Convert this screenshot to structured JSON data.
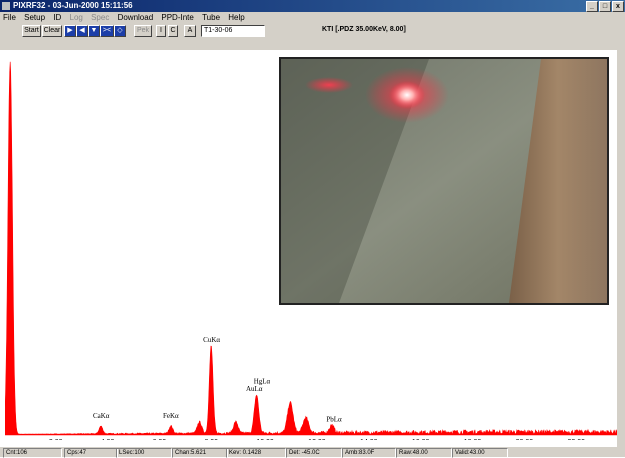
{
  "window": {
    "title": "PIXRF32 - 03-Jun-2000 15:11:56",
    "controls": [
      "_",
      "□",
      "x"
    ]
  },
  "menu": [
    "File",
    "Setup",
    "ID",
    "Log",
    "Spec",
    "Download",
    "PPD-Inte",
    "Tube",
    "Help"
  ],
  "menu_disabled": [
    false,
    false,
    false,
    true,
    true,
    false,
    false,
    false,
    false
  ],
  "toolbar": {
    "start": "Start",
    "clear": "Clear",
    "blue_buttons": [
      "▶",
      "◀",
      "▼",
      "><",
      "◇"
    ],
    "peak": "Pek",
    "i": "I",
    "c": "C",
    "a": "A",
    "run_id": "T1-30-06",
    "status": "KTI  [.PDZ 35.00KeV, 8.00]"
  },
  "chart_data": {
    "type": "line",
    "xlim": [
      0,
      23.6
    ],
    "ylim": [
      0,
      100
    ],
    "x_ticks": [
      "2.00",
      "4.00",
      "6.00",
      "8.00",
      "10.00",
      "12.00",
      "14.00",
      "16.00",
      "18.00",
      "20.00",
      "22.00"
    ],
    "x_tick_values": [
      2,
      4,
      6,
      8,
      10,
      12,
      14,
      16,
      18,
      20,
      22
    ],
    "peaks": [
      {
        "x": 0.2,
        "h": 98,
        "w": 0.12
      },
      {
        "x": 3.7,
        "h": 2,
        "w": 0.1
      },
      {
        "x": 6.4,
        "h": 2,
        "w": 0.1
      },
      {
        "x": 7.5,
        "h": 3,
        "w": 0.12
      },
      {
        "x": 7.95,
        "h": 23,
        "w": 0.1
      },
      {
        "x": 8.9,
        "h": 3,
        "w": 0.12
      },
      {
        "x": 9.7,
        "h": 10,
        "w": 0.12
      },
      {
        "x": 11.0,
        "h": 8,
        "w": 0.15
      },
      {
        "x": 11.6,
        "h": 4,
        "w": 0.15
      },
      {
        "x": 12.6,
        "h": 2,
        "w": 0.12
      }
    ],
    "color": "#ff0000",
    "annotations": [
      {
        "label": "CaKα",
        "x": 3.7,
        "y": 4
      },
      {
        "label": "FeKα",
        "x": 6.4,
        "y": 4
      },
      {
        "label": "CuKα",
        "x": 7.95,
        "y": 24
      },
      {
        "label": "HgLα",
        "x": 9.9,
        "y": 13
      },
      {
        "label": "AuLα",
        "x": 9.6,
        "y": 11
      },
      {
        "label": "PbLα",
        "x": 12.7,
        "y": 3
      }
    ]
  },
  "status": [
    {
      "text": "Cnt:106"
    },
    {
      "text": "Cps:47"
    },
    {
      "text": "LSec:100"
    },
    {
      "text": "Chan:5.621"
    },
    {
      "text": "Kev: 0.1428"
    },
    {
      "text": "Det: -45.0C"
    },
    {
      "text": "Amb:83.0F"
    },
    {
      "text": "Raw:48.00"
    },
    {
      "text": "Valid:43.00"
    }
  ]
}
